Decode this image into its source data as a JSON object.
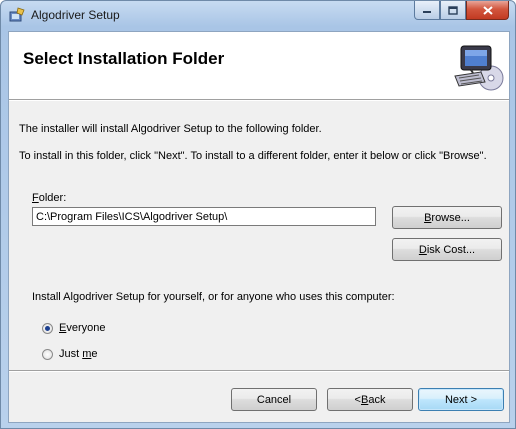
{
  "window": {
    "title": "Algodriver Setup"
  },
  "banner": {
    "title": "Select Installation Folder"
  },
  "body": {
    "intro_text": "The installer will install Algodriver Setup to the following folder.",
    "instructions_text": "To install in this folder, click \"Next\". To install to a different folder, enter it below or click \"Browse\".",
    "folder_label_mnemonic": "F",
    "folder_label_rest": "older:",
    "folder_value": "C:\\Program Files\\ICS\\Algodriver Setup\\",
    "browse_mnemonic": "B",
    "browse_rest": "rowse...",
    "disk_cost_mnemonic": "D",
    "disk_cost_rest": "isk Cost...",
    "install_for_text": "Install Algodriver Setup for yourself, or for anyone who uses this computer:",
    "radio_everyone_mnemonic": "E",
    "radio_everyone_rest": "veryone",
    "radio_justme_prefix": "Just ",
    "radio_justme_mnemonic": "m",
    "radio_justme_suffix": "e",
    "selected_option": "everyone"
  },
  "footer": {
    "cancel_label": "Cancel",
    "back_prefix": "< ",
    "back_mnemonic": "B",
    "back_rest": "ack",
    "next_label": "Next >"
  },
  "icons": [
    "setup-app-icon",
    "minimize-icon",
    "maximize-icon",
    "close-icon",
    "computer-cd-icon"
  ],
  "colors": {
    "titlebar": "#b9d1ec",
    "close_button": "#c23a22",
    "client_bg": "#f0f0f0",
    "default_button_border": "#3c7fb1"
  }
}
